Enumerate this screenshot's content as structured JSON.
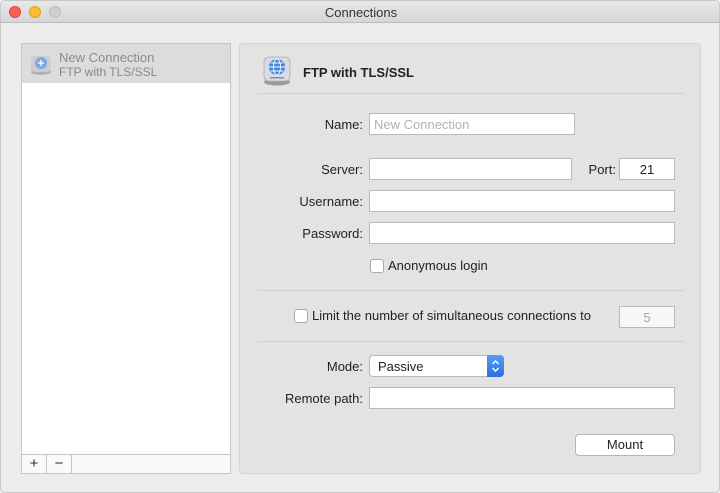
{
  "window": {
    "title": "Connections"
  },
  "sidebar": {
    "items": [
      {
        "name": "New Connection",
        "type": "FTP with TLS/SSL",
        "icon": "network-drive-icon"
      }
    ],
    "add_label": "+",
    "remove_label": "−"
  },
  "panel": {
    "header_title": "FTP with TLS/SSL",
    "header_icon": "network-drive-icon",
    "name_label": "Name:",
    "name_placeholder": "New Connection",
    "name_value": "",
    "server_label": "Server:",
    "server_value": "",
    "port_label": "Port:",
    "port_value": "21",
    "username_label": "Username:",
    "username_value": "",
    "password_label": "Password:",
    "password_value": "",
    "anonymous_label": "Anonymous login",
    "anonymous_checked": false,
    "limit_label": "Limit the number of simultaneous connections to",
    "limit_checked": false,
    "limit_value": "5",
    "mode_label": "Mode:",
    "mode_value": "Passive",
    "remote_path_label": "Remote path:",
    "remote_path_value": "",
    "mount_label": "Mount"
  },
  "colors": {
    "accent": "#2a6fe0",
    "selection": "#dcdcdc",
    "panel_bg": "#e3e3e3"
  }
}
